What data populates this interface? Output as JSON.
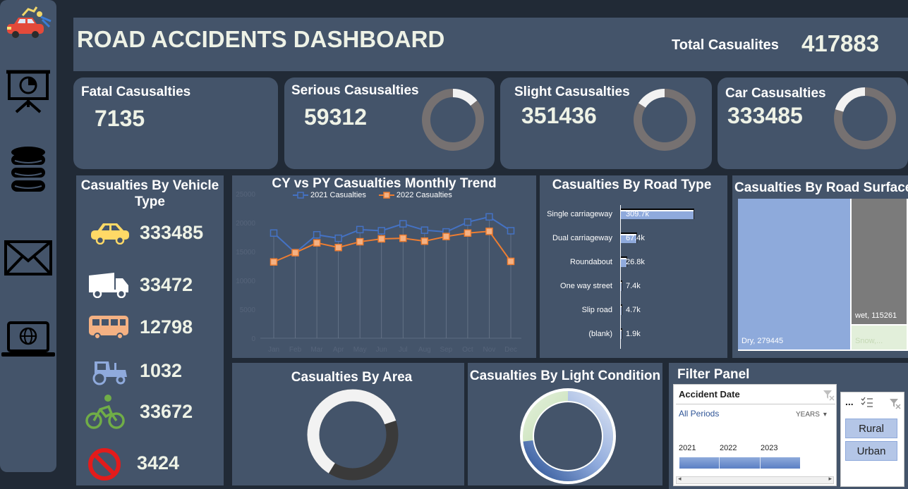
{
  "header": {
    "title": "ROAD ACCIDENTS DASHBOARD",
    "total_label": "Total Casualites",
    "total_value": "417883"
  },
  "sidebar": {
    "icons": [
      "car-crash-icon",
      "presentation-chart-icon",
      "database-icon",
      "mail-icon",
      "laptop-globe-icon"
    ]
  },
  "kpis": {
    "fatal": {
      "label": "Fatal Casusalties",
      "value": "7135"
    },
    "serious": {
      "label": "Serious Casusalties",
      "value": "59312",
      "share": 0.142
    },
    "slight": {
      "label": "Slight Casusalties",
      "value": "351436",
      "share": 0.841
    },
    "car": {
      "label": "Car Casusalties",
      "value": "333485",
      "share": 0.798
    }
  },
  "vehicle": {
    "title": "Casualties By Vehicle Type",
    "items": [
      {
        "icon": "car-icon",
        "value": "333485"
      },
      {
        "icon": "truck-icon",
        "value": "33472"
      },
      {
        "icon": "bus-icon",
        "value": "12798"
      },
      {
        "icon": "tractor-icon",
        "value": "1032"
      },
      {
        "icon": "bicycle-icon",
        "value": "33672"
      },
      {
        "icon": "prohibited-icon",
        "value": "3424"
      }
    ]
  },
  "trend": {
    "title": "CY vs PY Casualties Monthly Trend",
    "chart_data": {
      "type": "line",
      "title": "CY vs PY Casualties Monthly Trend",
      "categories": [
        "Jan",
        "Feb",
        "Mar",
        "Apr",
        "May",
        "Jun",
        "Jul",
        "Aug",
        "Sep",
        "Oct",
        "Nov",
        "Dec"
      ],
      "series": [
        {
          "name": "2021 Casualties",
          "color": "#4472c4",
          "values": [
            18200,
            14800,
            17900,
            17300,
            18800,
            18600,
            19800,
            18700,
            18400,
            20100,
            21000,
            18600
          ]
        },
        {
          "name": "2022 Casualties",
          "color": "#ed7d31",
          "values": [
            13200,
            14800,
            16500,
            15700,
            16700,
            17200,
            17300,
            16800,
            17600,
            18200,
            18500,
            13300
          ]
        }
      ],
      "ylim": [
        0,
        25000
      ],
      "yticks": [
        "0",
        "5000",
        "10000",
        "15000",
        "20000",
        "25000"
      ]
    }
  },
  "road_type": {
    "title": "Casualties By Road Type",
    "chart_data": {
      "type": "bar",
      "title": "Casualties By Road Type",
      "categories": [
        "Single carriageway",
        "Dual carriageway",
        "Roundabout",
        "One way street",
        "Slip road",
        "(blank)"
      ],
      "values": [
        309.7,
        67.4,
        26.8,
        7.4,
        4.7,
        1.9
      ],
      "labels": [
        "309.7k",
        "67.4k",
        "26.8k",
        "7.4k",
        "4.7k",
        "1.9k"
      ]
    }
  },
  "road_surface": {
    "title": "Casualties By Road Surface",
    "chart_data": {
      "type": "treemap",
      "title": "Casualties By Road Surface",
      "items": [
        {
          "label": "Dry, 279445",
          "value": 279445,
          "color": "#8eaadb"
        },
        {
          "label": "wet, 115261",
          "value": 115261,
          "color": "#7b7b7b"
        },
        {
          "label": "Snow,...",
          "value": 23177,
          "color": "#e2efda"
        }
      ]
    }
  },
  "area": {
    "title": "Casualties By Area",
    "chart_data": {
      "type": "pie",
      "title": "Casualties By Area",
      "values": [
        0.61,
        0.39
      ],
      "colors": [
        "#f2f2f2",
        "#3a3a3a"
      ]
    }
  },
  "light": {
    "title": "Casualties By Light Condition",
    "chart_data": {
      "type": "pie",
      "title": "Casualties By Light Condition",
      "values": [
        0.73,
        0.27
      ]
    }
  },
  "filter": {
    "title": "Filter Panel",
    "date_slicer": {
      "title": "Accident Date",
      "period": "All Periods",
      "level": "YEARS",
      "years": [
        "2021",
        "2022",
        "2023"
      ]
    },
    "area_slicer": {
      "title": "...",
      "options": [
        "Rural",
        "Urban"
      ]
    }
  }
}
